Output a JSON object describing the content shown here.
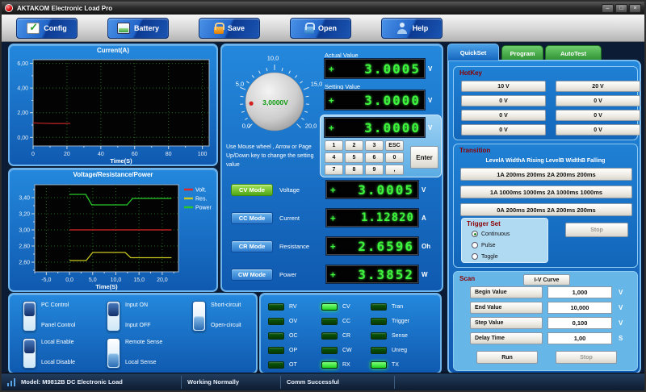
{
  "window": {
    "title": "AKTAKOM Electronic Load Pro",
    "minimize": "–",
    "maximize": "□",
    "close": "×"
  },
  "toolbar": {
    "buttons": [
      {
        "label": "Config",
        "icon": "checkmark-icon"
      },
      {
        "label": "Battery",
        "icon": "battery-icon"
      },
      {
        "label": "Save",
        "icon": "lock-orange-icon"
      },
      {
        "label": "Open",
        "icon": "lock-blue-icon"
      },
      {
        "label": "Help",
        "icon": "person-icon"
      }
    ]
  },
  "chart_data": [
    {
      "type": "line",
      "title": "Current(A)",
      "xlabel": "Time(S)",
      "xlim": [
        0,
        104
      ],
      "ylim": [
        -0.7,
        6.3
      ],
      "xtick_vals": [
        0,
        20,
        40,
        60,
        80,
        100
      ],
      "xtick_labels": [
        "0",
        "20",
        "40",
        "60",
        "80",
        "100"
      ],
      "ytick_vals": [
        0,
        2,
        4,
        6
      ],
      "ytick_labels": [
        "0,00",
        "2,00",
        "4,00",
        "6,00"
      ],
      "grid": true,
      "plot_bg": "#030303",
      "series": [
        {
          "name": "Current",
          "color": "#b22222",
          "points": [
            [
              0,
              1.18
            ],
            [
              3,
              1.16
            ],
            [
              7,
              1.14
            ],
            [
              12,
              1.12
            ],
            [
              17,
              1.12
            ],
            [
              22,
              1.13
            ]
          ]
        }
      ]
    },
    {
      "type": "line",
      "title": "Voltage/Resistance/Power",
      "xlabel": "Time(S)",
      "xlim": [
        -7.5,
        23.5
      ],
      "ylim": [
        2.48,
        3.56
      ],
      "xtick_vals": [
        -5,
        0,
        5,
        10,
        15,
        20
      ],
      "xtick_labels": [
        "-5,0",
        "0,0",
        "5,0",
        "10,0",
        "15,0",
        "20,0"
      ],
      "ytick_vals": [
        2.6,
        2.8,
        3.0,
        3.2,
        3.4
      ],
      "ytick_labels": [
        "2,60",
        "2,80",
        "3,00",
        "3,20",
        "3,40"
      ],
      "grid": true,
      "plot_bg": "#030303",
      "legend_position": "right",
      "legend": [
        {
          "label": "Volt.",
          "color": "#e02828"
        },
        {
          "label": "Res.",
          "color": "#c8c820"
        },
        {
          "label": "Power",
          "color": "#28c828"
        }
      ],
      "series": [
        {
          "name": "Power",
          "color": "#28c828",
          "points": [
            [
              0,
              3.44
            ],
            [
              3.5,
              3.44
            ],
            [
              4.8,
              3.31
            ],
            [
              12.4,
              3.31
            ],
            [
              13.6,
              3.39
            ],
            [
              22,
              3.39
            ]
          ]
        },
        {
          "name": "Volt.",
          "color": "#e02828",
          "points": [
            [
              0,
              3.0
            ],
            [
              22,
              3.0
            ]
          ]
        },
        {
          "name": "Res.",
          "color": "#c8c820",
          "points": [
            [
              0,
              2.62
            ],
            [
              3.6,
              2.62
            ],
            [
              5.0,
              2.72
            ],
            [
              12.0,
              2.72
            ],
            [
              13.2,
              2.655
            ],
            [
              22,
              2.655
            ]
          ]
        }
      ]
    }
  ],
  "knob": {
    "min": 0,
    "max": 20,
    "value": 3,
    "tick_step": 1,
    "major_step": 5,
    "value_label": "3,0000V",
    "scale_labels": [
      "0,0",
      "5,0",
      "10,0",
      "15,0",
      "20,0"
    ],
    "hint": "Use Mouse wheel , Arrow or Page Up/Down key to change the setting value"
  },
  "readouts": {
    "actual_label": "Actual Value",
    "setting_label": "Setting Value",
    "actual": {
      "sign": "+",
      "value": "3.0005",
      "unit": "V"
    },
    "setting": {
      "sign": "+",
      "value": "3.0000",
      "unit": "V"
    },
    "entry": {
      "sign": "+",
      "value": "3.0000",
      "unit": "V"
    }
  },
  "keypad": {
    "keys": [
      "1",
      "2",
      "3",
      "ESC",
      "4",
      "5",
      "6",
      "0",
      "7",
      "8",
      "9",
      ","
    ],
    "enter": "Enter"
  },
  "modes": [
    {
      "button": "CV Mode",
      "label": "Voltage",
      "sign": "+",
      "value": "3.0005",
      "unit": "V",
      "active": true
    },
    {
      "button": "CC Mode",
      "label": "Current",
      "sign": "+",
      "value": "1.12820",
      "unit": "A",
      "active": false
    },
    {
      "button": "CR Mode",
      "label": "Resistance",
      "sign": "+",
      "value": "2.6596",
      "unit": "Oh",
      "active": false
    },
    {
      "button": "CW Mode",
      "label": "Power",
      "sign": "+",
      "value": "3.3852",
      "unit": "W",
      "active": false
    }
  ],
  "toggles": [
    {
      "top": "PC Control",
      "bottom": "Panel Control",
      "down": false
    },
    {
      "top": "Input ON",
      "bottom": "Input OFF",
      "down": false
    },
    {
      "top": "Short-circuit",
      "bottom": "Open-circuit",
      "down": true
    },
    {
      "top": "Local Enable",
      "bottom": "Local Disable",
      "down": false
    },
    {
      "top": "Remote Sense",
      "bottom": "Local Sense",
      "down": true
    }
  ],
  "leds": {
    "col1": [
      {
        "label": "RV",
        "on": false
      },
      {
        "label": "OV",
        "on": false
      },
      {
        "label": "OC",
        "on": false
      },
      {
        "label": "OP",
        "on": false
      },
      {
        "label": "OT",
        "on": false
      }
    ],
    "col2": [
      {
        "label": "CV",
        "on": true
      },
      {
        "label": "CC",
        "on": false
      },
      {
        "label": "CR",
        "on": false
      },
      {
        "label": "CW",
        "on": false
      },
      {
        "label": "RX",
        "on": true
      }
    ],
    "col3": [
      {
        "label": "Tran",
        "on": false
      },
      {
        "label": "Trigger",
        "on": false
      },
      {
        "label": "Sense",
        "on": false
      },
      {
        "label": "Unreg",
        "on": false
      },
      {
        "label": "TX",
        "on": true
      }
    ]
  },
  "right_panel": {
    "tabs": [
      {
        "label": "QuickSet",
        "active": true
      },
      {
        "label": "Program",
        "active": false
      },
      {
        "label": "AutoTest",
        "active": false
      }
    ],
    "hotkey": {
      "title": "HotKey",
      "buttons": [
        "10 V",
        "20 V",
        "0 V",
        "0 V",
        "0 V",
        "0 V",
        "0 V",
        "0 V"
      ]
    },
    "transition": {
      "title": "Transition",
      "header": "LevelA WidthA Rising LevelB WidthB Falling",
      "buttons": [
        "1A 200ms 200ms 2A 200ms 200ms",
        "1A 1000ms 1000ms 2A 1000ms 1000ms",
        "0A 200ms 200ms 2A 200ms 200ms"
      ],
      "trigger": {
        "title": "Trigger Set",
        "options": [
          {
            "label": "Continuous",
            "checked": true
          },
          {
            "label": "Pulse",
            "checked": false
          },
          {
            "label": "Toggle",
            "checked": false
          }
        ]
      },
      "stop": {
        "label": "Stop",
        "disabled": true
      }
    },
    "scan": {
      "title": "Scan",
      "curve_button": "I-V Curve",
      "rows": [
        {
          "label": "Begin Value",
          "value": "1,000",
          "unit": "V"
        },
        {
          "label": "End Value",
          "value": "10,000",
          "unit": "V"
        },
        {
          "label": "Step Value",
          "value": "0,100",
          "unit": "V"
        },
        {
          "label": "Delay Time",
          "value": "1,00",
          "unit": "S"
        }
      ],
      "run": {
        "label": "Run",
        "disabled": false
      },
      "stop": {
        "label": "Stop",
        "disabled": true
      }
    }
  },
  "status_bar": {
    "model": "Model: M9812B DC Electronic Load",
    "status": "Working Normally",
    "comm": "Comm Successful"
  },
  "colors": {
    "panel_blue": "#1a73c8",
    "active_green": "#5cb821",
    "led_on": "#35e835",
    "seg_green": "#3cf53c",
    "label_red": "#8b0000",
    "grid_green": "#1d6e1d"
  }
}
